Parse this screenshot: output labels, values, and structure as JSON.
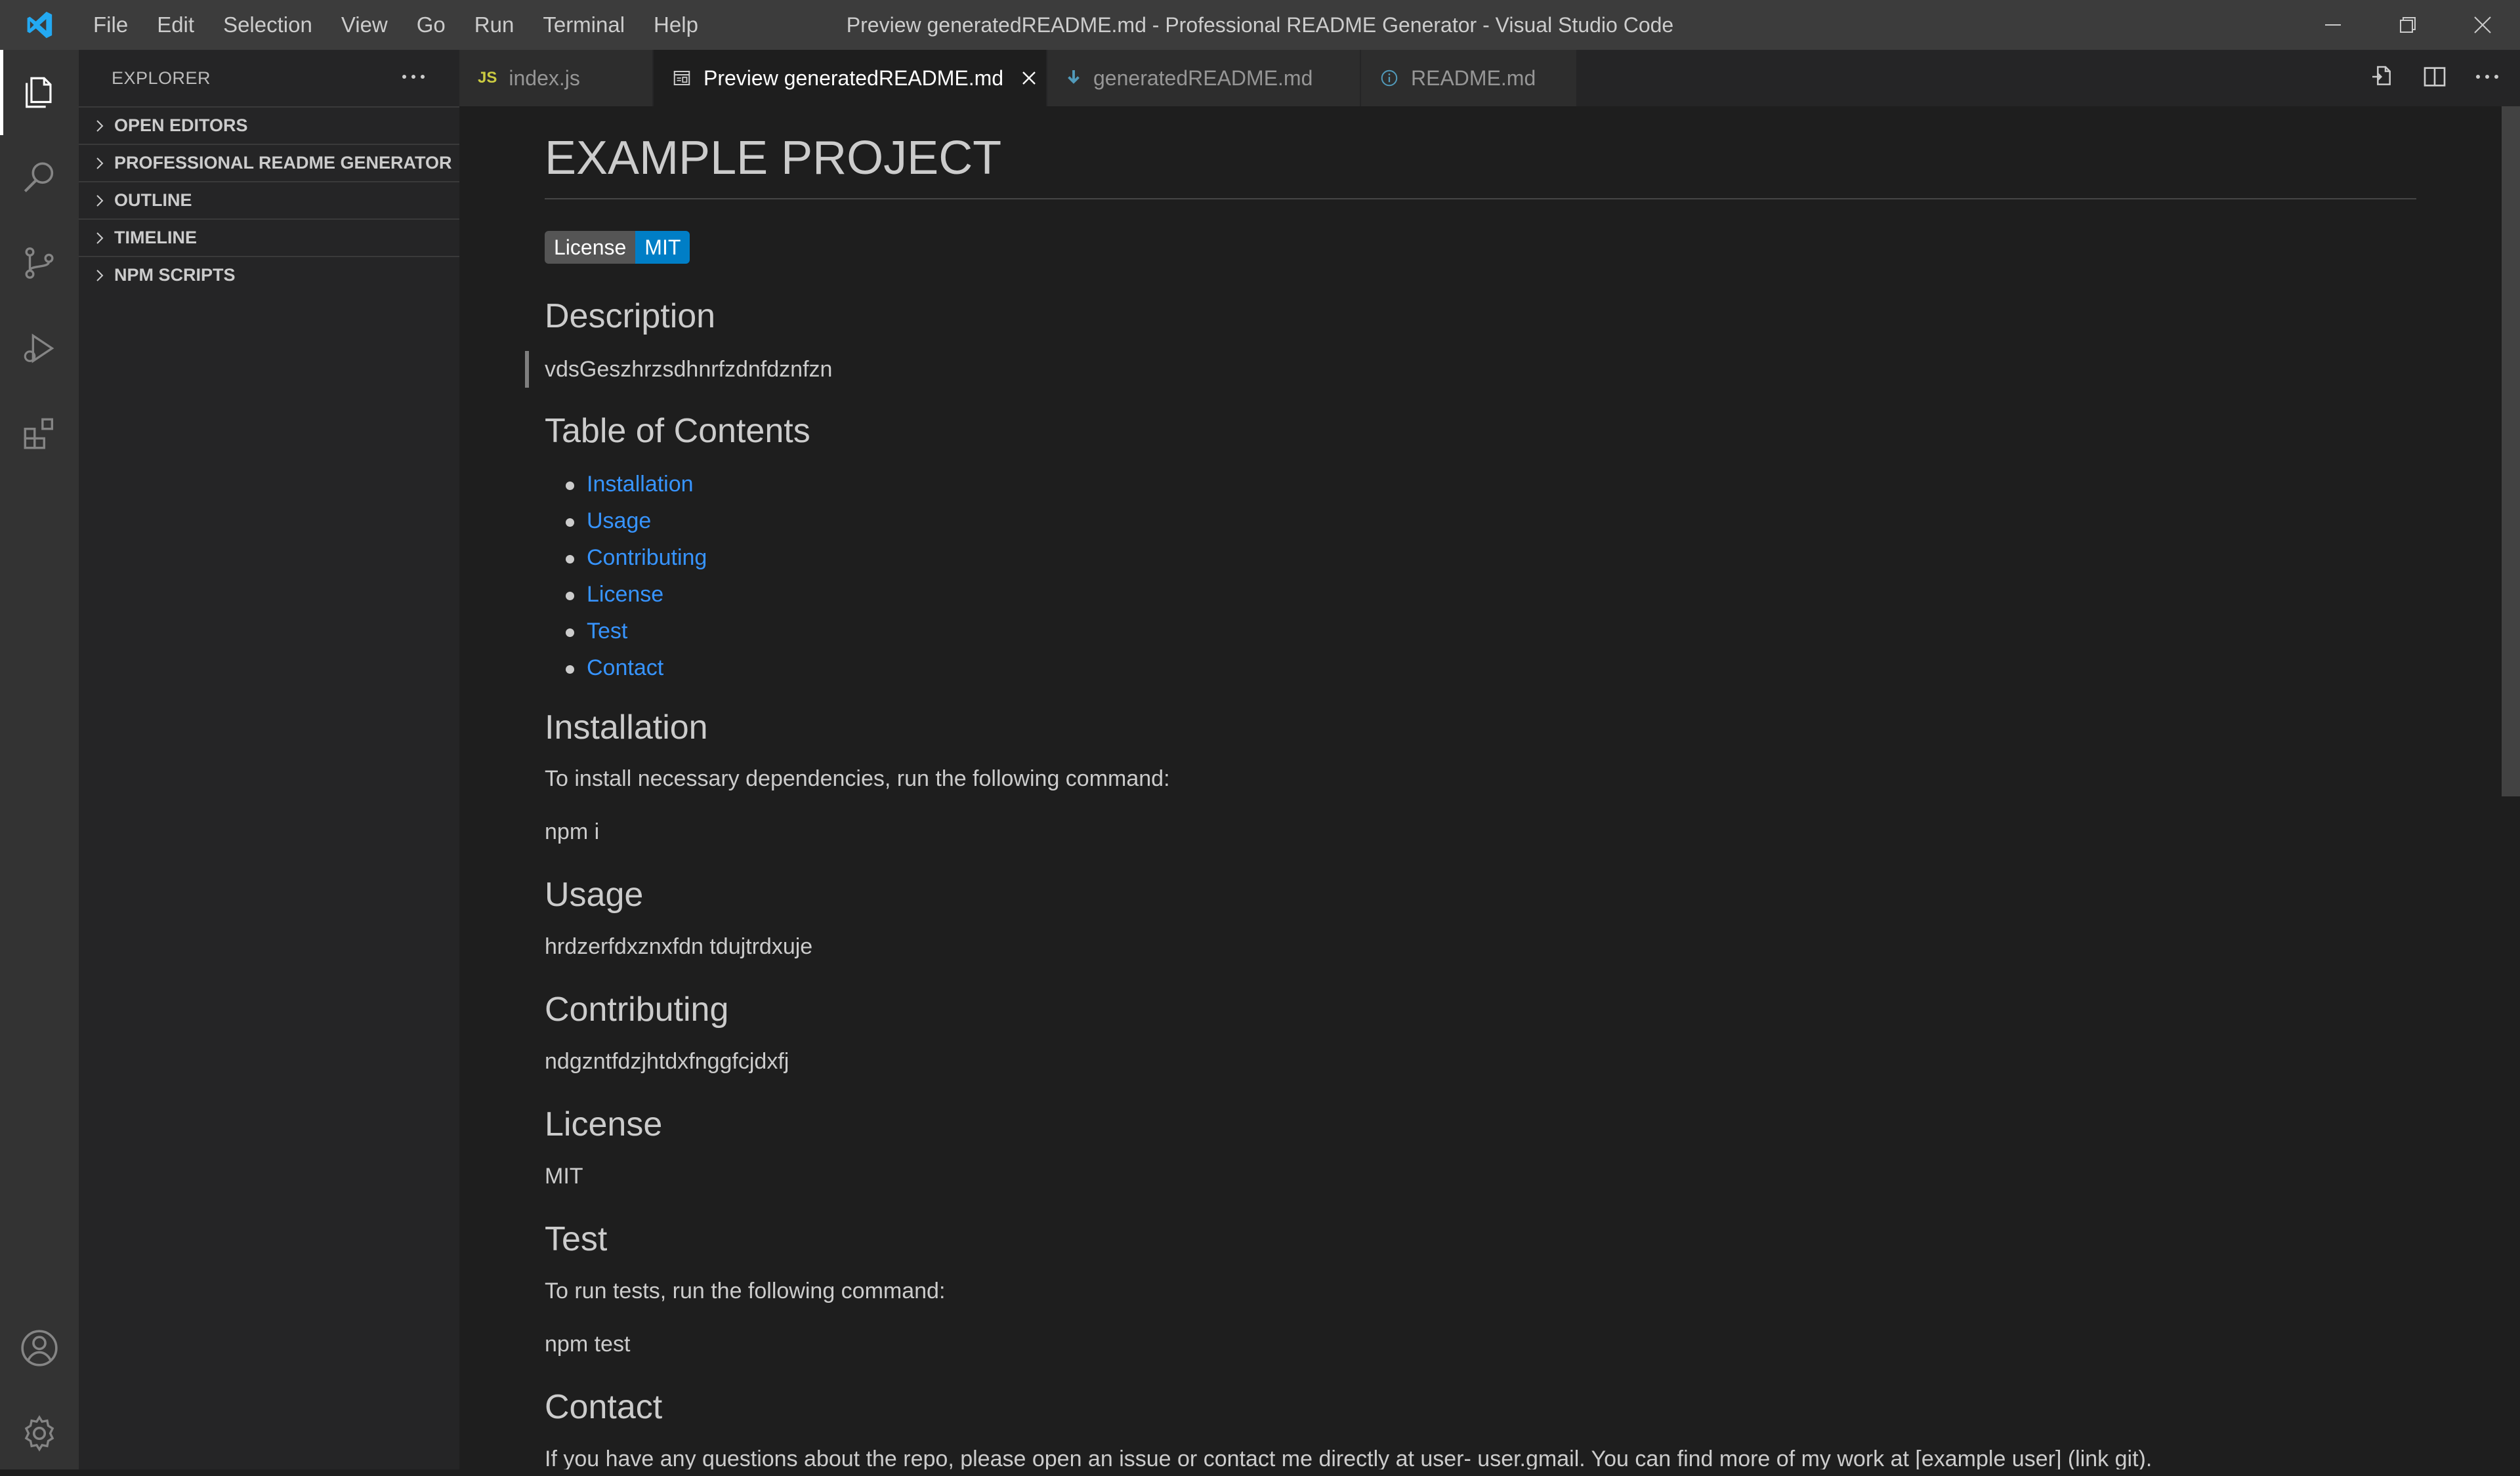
{
  "window": {
    "title": "Preview generatedREADME.md - Professional README Generator - Visual Studio Code"
  },
  "menu": [
    "File",
    "Edit",
    "Selection",
    "View",
    "Go",
    "Run",
    "Terminal",
    "Help"
  ],
  "activity_bar": {
    "icons": [
      "explorer-icon",
      "search-icon",
      "source-control-icon",
      "run-debug-icon",
      "extensions-icon",
      "account-icon",
      "settings-gear-icon"
    ]
  },
  "sidebar": {
    "title": "EXPLORER",
    "sections": [
      "OPEN EDITORS",
      "PROFESSIONAL README GENERATOR",
      "OUTLINE",
      "TIMELINE",
      "NPM SCRIPTS"
    ]
  },
  "tabs": [
    {
      "label": "index.js",
      "icon": "js-icon",
      "active": false
    },
    {
      "label": "Preview generatedREADME.md",
      "icon": "preview-icon",
      "active": true
    },
    {
      "label": "generatedREADME.md",
      "icon": "markdown-icon",
      "active": false
    },
    {
      "label": "README.md",
      "icon": "info-icon",
      "active": false
    }
  ],
  "tab_js_glyph": "JS",
  "preview": {
    "title": "EXAMPLE PROJECT",
    "badge": {
      "left": "License",
      "right": "MIT"
    },
    "description_heading": "Description",
    "description_text": "vdsGeszhrzsdhnrfzdnfdznfzn",
    "toc_heading": "Table of Contents",
    "toc_items": [
      "Installation",
      "Usage",
      "Contributing",
      "License",
      "Test",
      "Contact"
    ],
    "installation_heading": "Installation",
    "installation_text": "To install necessary dependencies, run the following command:",
    "installation_cmd": "npm i",
    "usage_heading": "Usage",
    "usage_text": "hrdzerfdxznxfdn tdujtrdxuje",
    "contributing_heading": "Contributing",
    "contributing_text": "ndgzntfdzjhtdxfnggfcjdxfj",
    "license_heading": "License",
    "license_text": "MIT",
    "test_heading": "Test",
    "test_text": "To run tests, run the following command:",
    "test_cmd": "npm test",
    "contact_heading": "Contact",
    "contact_text": "If you have any questions about the repo, please open an issue or contact me directly at user- user.gmail. You can find more of my work at [example user] (link git)."
  },
  "colors": {
    "titlebar": "#3c3c3c",
    "activitybar": "#333333",
    "sidebar": "#252526",
    "editor": "#1e1e1e",
    "link": "#3794ff",
    "badge_left": "#555555",
    "badge_right": "#007ec6",
    "vscode_blue": "#23a9f2"
  }
}
